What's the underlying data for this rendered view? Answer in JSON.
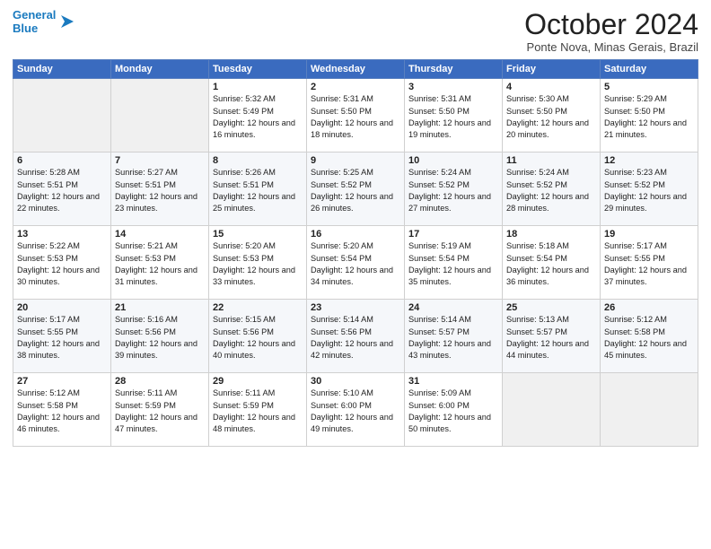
{
  "header": {
    "logo_line1": "General",
    "logo_line2": "Blue",
    "month": "October 2024",
    "location": "Ponte Nova, Minas Gerais, Brazil"
  },
  "days_of_week": [
    "Sunday",
    "Monday",
    "Tuesday",
    "Wednesday",
    "Thursday",
    "Friday",
    "Saturday"
  ],
  "weeks": [
    [
      {
        "num": "",
        "sunrise": "",
        "sunset": "",
        "daylight": "",
        "empty": true
      },
      {
        "num": "",
        "sunrise": "",
        "sunset": "",
        "daylight": "",
        "empty": true
      },
      {
        "num": "1",
        "sunrise": "Sunrise: 5:32 AM",
        "sunset": "Sunset: 5:49 PM",
        "daylight": "Daylight: 12 hours and 16 minutes.",
        "empty": false
      },
      {
        "num": "2",
        "sunrise": "Sunrise: 5:31 AM",
        "sunset": "Sunset: 5:50 PM",
        "daylight": "Daylight: 12 hours and 18 minutes.",
        "empty": false
      },
      {
        "num": "3",
        "sunrise": "Sunrise: 5:31 AM",
        "sunset": "Sunset: 5:50 PM",
        "daylight": "Daylight: 12 hours and 19 minutes.",
        "empty": false
      },
      {
        "num": "4",
        "sunrise": "Sunrise: 5:30 AM",
        "sunset": "Sunset: 5:50 PM",
        "daylight": "Daylight: 12 hours and 20 minutes.",
        "empty": false
      },
      {
        "num": "5",
        "sunrise": "Sunrise: 5:29 AM",
        "sunset": "Sunset: 5:50 PM",
        "daylight": "Daylight: 12 hours and 21 minutes.",
        "empty": false
      }
    ],
    [
      {
        "num": "6",
        "sunrise": "Sunrise: 5:28 AM",
        "sunset": "Sunset: 5:51 PM",
        "daylight": "Daylight: 12 hours and 22 minutes.",
        "empty": false
      },
      {
        "num": "7",
        "sunrise": "Sunrise: 5:27 AM",
        "sunset": "Sunset: 5:51 PM",
        "daylight": "Daylight: 12 hours and 23 minutes.",
        "empty": false
      },
      {
        "num": "8",
        "sunrise": "Sunrise: 5:26 AM",
        "sunset": "Sunset: 5:51 PM",
        "daylight": "Daylight: 12 hours and 25 minutes.",
        "empty": false
      },
      {
        "num": "9",
        "sunrise": "Sunrise: 5:25 AM",
        "sunset": "Sunset: 5:52 PM",
        "daylight": "Daylight: 12 hours and 26 minutes.",
        "empty": false
      },
      {
        "num": "10",
        "sunrise": "Sunrise: 5:24 AM",
        "sunset": "Sunset: 5:52 PM",
        "daylight": "Daylight: 12 hours and 27 minutes.",
        "empty": false
      },
      {
        "num": "11",
        "sunrise": "Sunrise: 5:24 AM",
        "sunset": "Sunset: 5:52 PM",
        "daylight": "Daylight: 12 hours and 28 minutes.",
        "empty": false
      },
      {
        "num": "12",
        "sunrise": "Sunrise: 5:23 AM",
        "sunset": "Sunset: 5:52 PM",
        "daylight": "Daylight: 12 hours and 29 minutes.",
        "empty": false
      }
    ],
    [
      {
        "num": "13",
        "sunrise": "Sunrise: 5:22 AM",
        "sunset": "Sunset: 5:53 PM",
        "daylight": "Daylight: 12 hours and 30 minutes.",
        "empty": false
      },
      {
        "num": "14",
        "sunrise": "Sunrise: 5:21 AM",
        "sunset": "Sunset: 5:53 PM",
        "daylight": "Daylight: 12 hours and 31 minutes.",
        "empty": false
      },
      {
        "num": "15",
        "sunrise": "Sunrise: 5:20 AM",
        "sunset": "Sunset: 5:53 PM",
        "daylight": "Daylight: 12 hours and 33 minutes.",
        "empty": false
      },
      {
        "num": "16",
        "sunrise": "Sunrise: 5:20 AM",
        "sunset": "Sunset: 5:54 PM",
        "daylight": "Daylight: 12 hours and 34 minutes.",
        "empty": false
      },
      {
        "num": "17",
        "sunrise": "Sunrise: 5:19 AM",
        "sunset": "Sunset: 5:54 PM",
        "daylight": "Daylight: 12 hours and 35 minutes.",
        "empty": false
      },
      {
        "num": "18",
        "sunrise": "Sunrise: 5:18 AM",
        "sunset": "Sunset: 5:54 PM",
        "daylight": "Daylight: 12 hours and 36 minutes.",
        "empty": false
      },
      {
        "num": "19",
        "sunrise": "Sunrise: 5:17 AM",
        "sunset": "Sunset: 5:55 PM",
        "daylight": "Daylight: 12 hours and 37 minutes.",
        "empty": false
      }
    ],
    [
      {
        "num": "20",
        "sunrise": "Sunrise: 5:17 AM",
        "sunset": "Sunset: 5:55 PM",
        "daylight": "Daylight: 12 hours and 38 minutes.",
        "empty": false
      },
      {
        "num": "21",
        "sunrise": "Sunrise: 5:16 AM",
        "sunset": "Sunset: 5:56 PM",
        "daylight": "Daylight: 12 hours and 39 minutes.",
        "empty": false
      },
      {
        "num": "22",
        "sunrise": "Sunrise: 5:15 AM",
        "sunset": "Sunset: 5:56 PM",
        "daylight": "Daylight: 12 hours and 40 minutes.",
        "empty": false
      },
      {
        "num": "23",
        "sunrise": "Sunrise: 5:14 AM",
        "sunset": "Sunset: 5:56 PM",
        "daylight": "Daylight: 12 hours and 42 minutes.",
        "empty": false
      },
      {
        "num": "24",
        "sunrise": "Sunrise: 5:14 AM",
        "sunset": "Sunset: 5:57 PM",
        "daylight": "Daylight: 12 hours and 43 minutes.",
        "empty": false
      },
      {
        "num": "25",
        "sunrise": "Sunrise: 5:13 AM",
        "sunset": "Sunset: 5:57 PM",
        "daylight": "Daylight: 12 hours and 44 minutes.",
        "empty": false
      },
      {
        "num": "26",
        "sunrise": "Sunrise: 5:12 AM",
        "sunset": "Sunset: 5:58 PM",
        "daylight": "Daylight: 12 hours and 45 minutes.",
        "empty": false
      }
    ],
    [
      {
        "num": "27",
        "sunrise": "Sunrise: 5:12 AM",
        "sunset": "Sunset: 5:58 PM",
        "daylight": "Daylight: 12 hours and 46 minutes.",
        "empty": false
      },
      {
        "num": "28",
        "sunrise": "Sunrise: 5:11 AM",
        "sunset": "Sunset: 5:59 PM",
        "daylight": "Daylight: 12 hours and 47 minutes.",
        "empty": false
      },
      {
        "num": "29",
        "sunrise": "Sunrise: 5:11 AM",
        "sunset": "Sunset: 5:59 PM",
        "daylight": "Daylight: 12 hours and 48 minutes.",
        "empty": false
      },
      {
        "num": "30",
        "sunrise": "Sunrise: 5:10 AM",
        "sunset": "Sunset: 6:00 PM",
        "daylight": "Daylight: 12 hours and 49 minutes.",
        "empty": false
      },
      {
        "num": "31",
        "sunrise": "Sunrise: 5:09 AM",
        "sunset": "Sunset: 6:00 PM",
        "daylight": "Daylight: 12 hours and 50 minutes.",
        "empty": false
      },
      {
        "num": "",
        "sunrise": "",
        "sunset": "",
        "daylight": "",
        "empty": true
      },
      {
        "num": "",
        "sunrise": "",
        "sunset": "",
        "daylight": "",
        "empty": true
      }
    ]
  ]
}
